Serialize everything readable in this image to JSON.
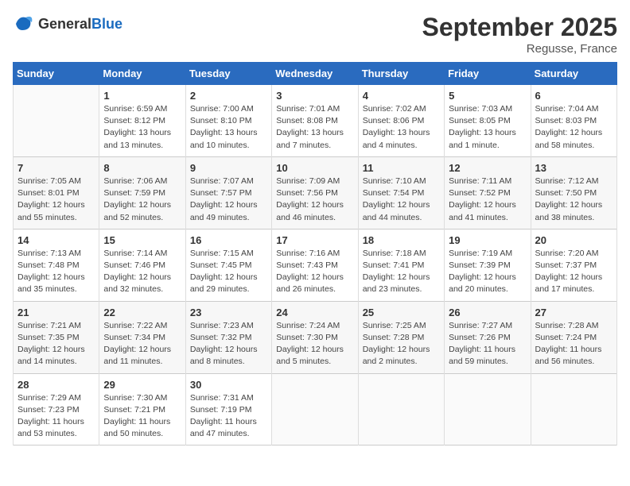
{
  "logo": {
    "text_general": "General",
    "text_blue": "Blue"
  },
  "title": "September 2025",
  "location": "Regusse, France",
  "days_of_week": [
    "Sunday",
    "Monday",
    "Tuesday",
    "Wednesday",
    "Thursday",
    "Friday",
    "Saturday"
  ],
  "weeks": [
    [
      {
        "day": "",
        "info": ""
      },
      {
        "day": "1",
        "info": "Sunrise: 6:59 AM\nSunset: 8:12 PM\nDaylight: 13 hours\nand 13 minutes."
      },
      {
        "day": "2",
        "info": "Sunrise: 7:00 AM\nSunset: 8:10 PM\nDaylight: 13 hours\nand 10 minutes."
      },
      {
        "day": "3",
        "info": "Sunrise: 7:01 AM\nSunset: 8:08 PM\nDaylight: 13 hours\nand 7 minutes."
      },
      {
        "day": "4",
        "info": "Sunrise: 7:02 AM\nSunset: 8:06 PM\nDaylight: 13 hours\nand 4 minutes."
      },
      {
        "day": "5",
        "info": "Sunrise: 7:03 AM\nSunset: 8:05 PM\nDaylight: 13 hours\nand 1 minute."
      },
      {
        "day": "6",
        "info": "Sunrise: 7:04 AM\nSunset: 8:03 PM\nDaylight: 12 hours\nand 58 minutes."
      }
    ],
    [
      {
        "day": "7",
        "info": "Sunrise: 7:05 AM\nSunset: 8:01 PM\nDaylight: 12 hours\nand 55 minutes."
      },
      {
        "day": "8",
        "info": "Sunrise: 7:06 AM\nSunset: 7:59 PM\nDaylight: 12 hours\nand 52 minutes."
      },
      {
        "day": "9",
        "info": "Sunrise: 7:07 AM\nSunset: 7:57 PM\nDaylight: 12 hours\nand 49 minutes."
      },
      {
        "day": "10",
        "info": "Sunrise: 7:09 AM\nSunset: 7:56 PM\nDaylight: 12 hours\nand 46 minutes."
      },
      {
        "day": "11",
        "info": "Sunrise: 7:10 AM\nSunset: 7:54 PM\nDaylight: 12 hours\nand 44 minutes."
      },
      {
        "day": "12",
        "info": "Sunrise: 7:11 AM\nSunset: 7:52 PM\nDaylight: 12 hours\nand 41 minutes."
      },
      {
        "day": "13",
        "info": "Sunrise: 7:12 AM\nSunset: 7:50 PM\nDaylight: 12 hours\nand 38 minutes."
      }
    ],
    [
      {
        "day": "14",
        "info": "Sunrise: 7:13 AM\nSunset: 7:48 PM\nDaylight: 12 hours\nand 35 minutes."
      },
      {
        "day": "15",
        "info": "Sunrise: 7:14 AM\nSunset: 7:46 PM\nDaylight: 12 hours\nand 32 minutes."
      },
      {
        "day": "16",
        "info": "Sunrise: 7:15 AM\nSunset: 7:45 PM\nDaylight: 12 hours\nand 29 minutes."
      },
      {
        "day": "17",
        "info": "Sunrise: 7:16 AM\nSunset: 7:43 PM\nDaylight: 12 hours\nand 26 minutes."
      },
      {
        "day": "18",
        "info": "Sunrise: 7:18 AM\nSunset: 7:41 PM\nDaylight: 12 hours\nand 23 minutes."
      },
      {
        "day": "19",
        "info": "Sunrise: 7:19 AM\nSunset: 7:39 PM\nDaylight: 12 hours\nand 20 minutes."
      },
      {
        "day": "20",
        "info": "Sunrise: 7:20 AM\nSunset: 7:37 PM\nDaylight: 12 hours\nand 17 minutes."
      }
    ],
    [
      {
        "day": "21",
        "info": "Sunrise: 7:21 AM\nSunset: 7:35 PM\nDaylight: 12 hours\nand 14 minutes."
      },
      {
        "day": "22",
        "info": "Sunrise: 7:22 AM\nSunset: 7:34 PM\nDaylight: 12 hours\nand 11 minutes."
      },
      {
        "day": "23",
        "info": "Sunrise: 7:23 AM\nSunset: 7:32 PM\nDaylight: 12 hours\nand 8 minutes."
      },
      {
        "day": "24",
        "info": "Sunrise: 7:24 AM\nSunset: 7:30 PM\nDaylight: 12 hours\nand 5 minutes."
      },
      {
        "day": "25",
        "info": "Sunrise: 7:25 AM\nSunset: 7:28 PM\nDaylight: 12 hours\nand 2 minutes."
      },
      {
        "day": "26",
        "info": "Sunrise: 7:27 AM\nSunset: 7:26 PM\nDaylight: 11 hours\nand 59 minutes."
      },
      {
        "day": "27",
        "info": "Sunrise: 7:28 AM\nSunset: 7:24 PM\nDaylight: 11 hours\nand 56 minutes."
      }
    ],
    [
      {
        "day": "28",
        "info": "Sunrise: 7:29 AM\nSunset: 7:23 PM\nDaylight: 11 hours\nand 53 minutes."
      },
      {
        "day": "29",
        "info": "Sunrise: 7:30 AM\nSunset: 7:21 PM\nDaylight: 11 hours\nand 50 minutes."
      },
      {
        "day": "30",
        "info": "Sunrise: 7:31 AM\nSunset: 7:19 PM\nDaylight: 11 hours\nand 47 minutes."
      },
      {
        "day": "",
        "info": ""
      },
      {
        "day": "",
        "info": ""
      },
      {
        "day": "",
        "info": ""
      },
      {
        "day": "",
        "info": ""
      }
    ]
  ]
}
